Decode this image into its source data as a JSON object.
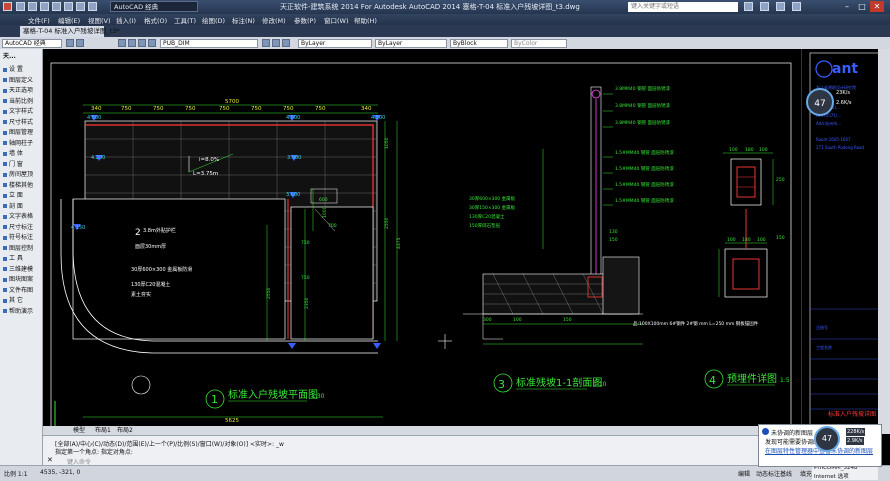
{
  "titlebar": {
    "workspace": "AutoCAD 经典",
    "title": "天正软件-建筑系统 2014   For Autodesk AutoCAD 2014        塞格-T-04 标准入户残坡详图_t3.dwg",
    "search_placeholder": "键入关键字或短语"
  },
  "menu": [
    "文件(F)",
    "编辑(E)",
    "视图(V)",
    "插入(I)",
    "格式(O)",
    "工具(T)",
    "绘图(D)",
    "标注(N)",
    "修改(M)",
    "参数(P)",
    "窗口(W)",
    "帮助(H)"
  ],
  "doc_tab": "塞格-T-04 标准入户残坡详图_t3*",
  "toolbar": {
    "workspace": "AutoCAD 经典",
    "dimstyle": "PUB_DIM",
    "layer": "ByLayer",
    "linetype": "ByLayer",
    "lineweight": "ByBlock",
    "plotstyle": "ByColor"
  },
  "palette": {
    "header": "天...",
    "items": [
      "设 置",
      "图层定义",
      "天正选项",
      "当前比例",
      "文字样式",
      "尺寸样式",
      "图层管理",
      "轴网柱子",
      "墙 体",
      "门 窗",
      "房间屋顶",
      "楼梯其他",
      "立 面",
      "剖 面",
      "文字表格",
      "尺寸标注",
      "符号标注",
      "图层控制",
      "工 具",
      "三维建模",
      "图块图案",
      "文件布图",
      "其 它",
      "帮助演示"
    ]
  },
  "drawing": {
    "dims_top": [
      "340",
      "750",
      "750",
      "750",
      "750",
      "750",
      "750",
      "750",
      "340"
    ],
    "total_top": "5700",
    "elevations": [
      "4.500",
      "4.500",
      "4.500",
      "4.200",
      "3.900",
      "3.600",
      "4.150",
      "4.150"
    ],
    "slope_note": "i=8.0%",
    "slope_len": "L=3.75m",
    "right_dims": [
      "1050",
      "2550",
      "1000",
      "600",
      "750",
      "750",
      "2550",
      "4375",
      "2350",
      "700"
    ],
    "bottom_total": "5625",
    "notes_plan": [
      "2",
      "3.8m外贴护栏",
      "面层30mm厚",
      "30厚600×300 金属板防滑",
      "130厚C20混凝土",
      "素土夯实"
    ],
    "plan_title_num": "1",
    "plan_title": "标准入户残坡平面图",
    "plan_scale": "1:30",
    "section_title_num": "3",
    "section_title": "标准残坡1-1剖面图",
    "section_scale": "1:10",
    "detail_title_num": "4",
    "detail_title": "预埋件详图",
    "detail_scale": "1:5",
    "section_notes": [
      "3.8MM40 钢管 面层防锈漆",
      "3.8MM40 钢管 面层防锈漆",
      "3.8MM40 钢管 面层防锈漆",
      "1.5#MM40 钢管 面层防锈漆",
      "1.5#MM40 钢管 面层防锈漆",
      "1.5#MM40 钢管 面层防锈漆",
      "1.5#MM40 钢管 面层防锈漆",
      "30厚600×300 金属板",
      "30厚150×300 金属板",
      "130厚C20混凝土",
      "150厚碎石垫层"
    ],
    "section_dims": [
      "130",
      "150",
      "300",
      "100",
      "150"
    ],
    "section_footnote": "品:100X100mm  6#钢件 2#钢 mm L=250 mm  钢板锚固件",
    "detail_dims": [
      "100",
      "180",
      "100",
      "250",
      "150",
      "100",
      "180",
      "100"
    ],
    "watermark": "ant",
    "right_info": [
      "浙江省建筑设计研究院",
      "Tel:(0571)...",
      "Fax:(0571)...",
      "Add:杭州市...",
      "Room:1605-1607",
      "271 South Pudong Road",
      "注册号",
      "工程名称",
      "标准入户残坡详图"
    ],
    "side_gauge": "47",
    "side_speed1": "23K/s",
    "side_speed2": "2.6K/s"
  },
  "layout_tabs": [
    "模型",
    "布局1",
    "布局2"
  ],
  "command": {
    "line1": "[全部(A)/中心(C)/动态(D)/范围(E)/上一个(P)/比例(S)/窗口(W)/对象(O)] <实时>: _w",
    "line2": "指定第一个角点: 指定对角点:",
    "prompt": "键入命令"
  },
  "status": {
    "scale": "比例 1:1",
    "coords": "4535, -321, 0",
    "toggles": [
      "编辑",
      "动态标注",
      "基线",
      "填充",
      "加粗",
      "动态标注"
    ],
    "user": "PHICOMM_5248"
  },
  "popup": {
    "title": "未协调的新图层",
    "body": "发现可能需要协调的新图层",
    "link": "在图层特性管理器中查看未协调的新图层",
    "gauge": "47",
    "speed_up": "228K/s",
    "speed_down": "2.9K/s"
  },
  "ie_label": "Internet 选项",
  "colors": {
    "plan_line": "#ffffff",
    "dim": "#39e639",
    "red": "#ff3b3b",
    "cyan": "#39d7e6",
    "magenta": "#ff49ff",
    "blue": "#3a5dff",
    "yellow": "#e8e63a"
  }
}
